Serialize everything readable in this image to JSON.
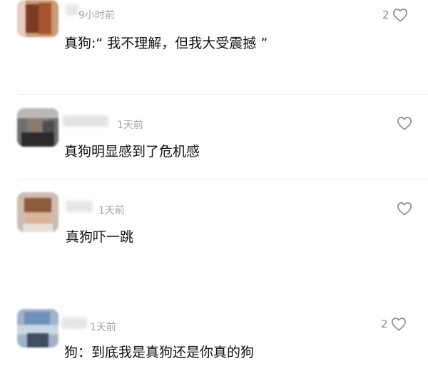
{
  "comments": [
    {
      "time": "9小时前",
      "text": "真狗:“ 我不理解，但我大受震撼 ”",
      "likes": "2",
      "icon": "heart-outline-icon"
    },
    {
      "time": "1天前",
      "text": "真狗明显感到了危机感",
      "likes": "",
      "icon": "heart-outline-icon"
    },
    {
      "time": "1天前",
      "text": "真狗吓一跳",
      "likes": "",
      "icon": "heart-outline-icon"
    },
    {
      "time": "1天前",
      "text": "狗：到底我是真狗还是你真的狗",
      "likes": "2",
      "icon": "heart-outline-icon"
    }
  ]
}
